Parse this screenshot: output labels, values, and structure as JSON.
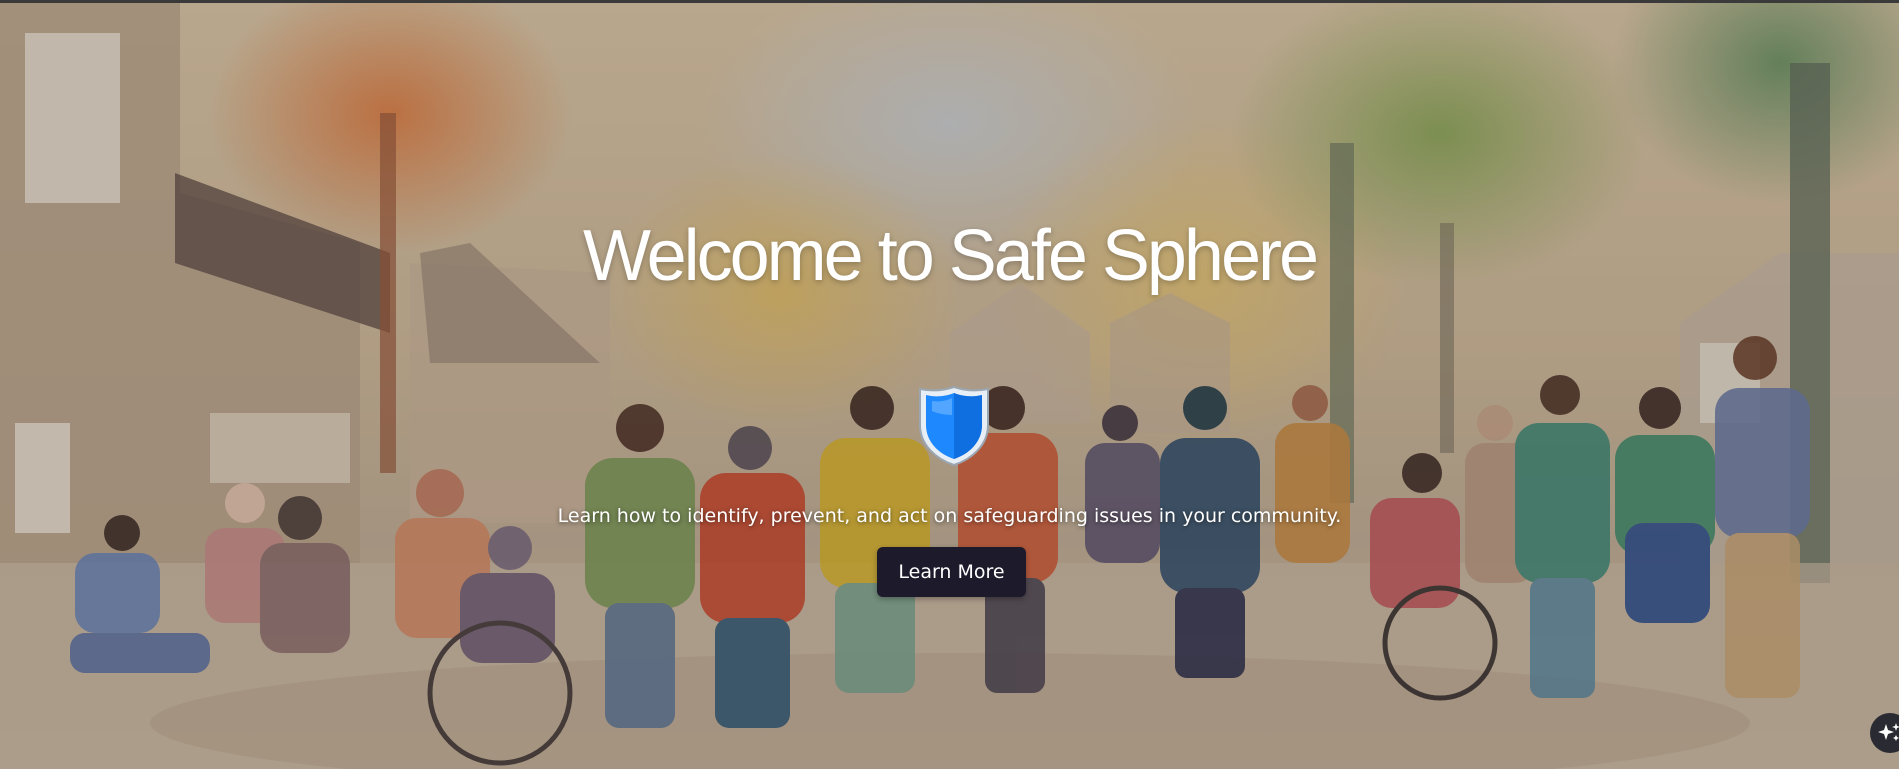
{
  "hero": {
    "title": "Welcome to Safe Sphere",
    "tagline": "Learn how to identify, prevent, and act on safeguarding issues in your community.",
    "cta_label": "Learn More",
    "icon": "shield-icon"
  },
  "floating_button": {
    "icon": "sparkle-icon"
  },
  "colors": {
    "title_text": "#ffffff",
    "button_bg": "#1c1a2b",
    "shield_blue": "#1e88ff"
  }
}
